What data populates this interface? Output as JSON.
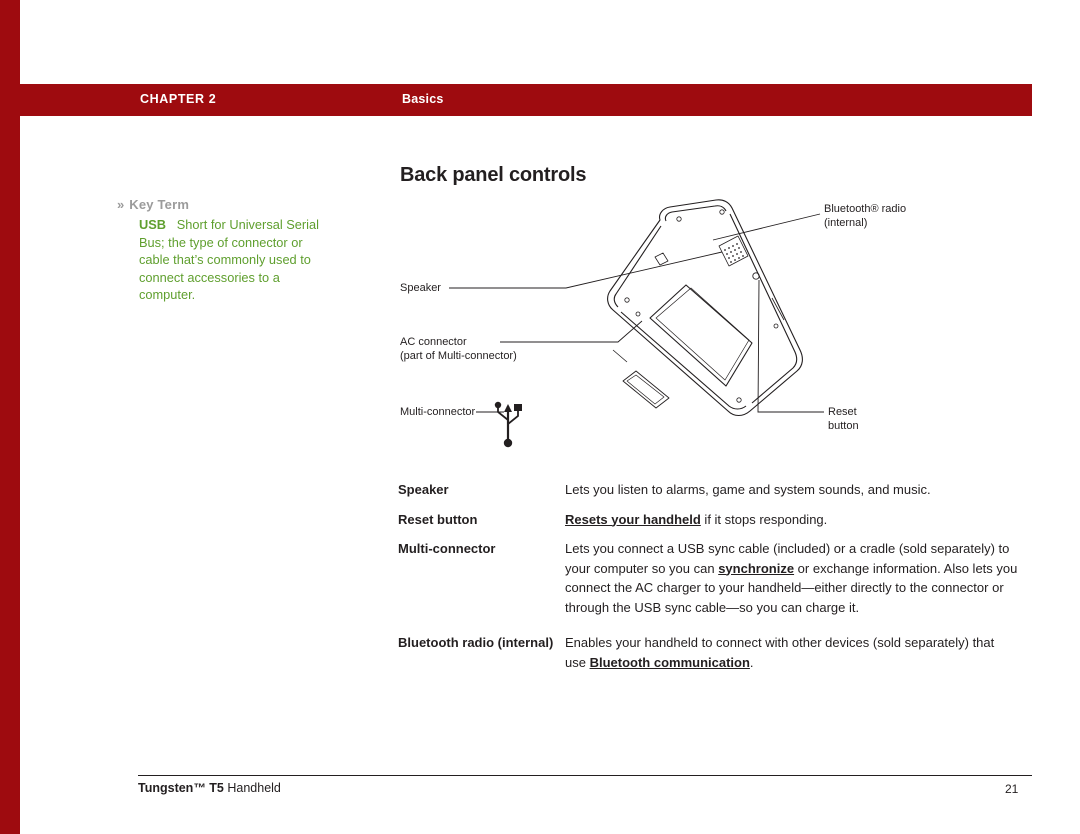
{
  "header": {
    "chapter": "CHAPTER 2",
    "section": "Basics",
    "band_color": "#9e0b0f"
  },
  "page": {
    "title": "Back panel controls"
  },
  "keyterm": {
    "chevrons": "»",
    "label": "Key Term",
    "term": "USB",
    "definition": "Short for Universal Serial Bus; the type of connector or cable that’s commonly used to connect accessories to a computer.",
    "color": "#5f9f2e"
  },
  "figure": {
    "labels": [
      {
        "name": "bluetooth-radio",
        "text": "Bluetooth® radio\n(internal)"
      },
      {
        "name": "speaker",
        "text": "Speaker"
      },
      {
        "name": "ac-connector",
        "text": "AC connector\n(part of Multi-connector)"
      },
      {
        "name": "multi-connector",
        "text": "Multi-connector"
      },
      {
        "name": "reset-button",
        "text": "Reset\nbutton"
      }
    ]
  },
  "definitions": [
    {
      "term": "Speaker",
      "desc_html": "Lets you listen to alarms, game and system sounds, and music."
    },
    {
      "term": "Reset button",
      "desc_html": "<span class=\"link-ul\">Resets your handheld</span> if it stops responding."
    },
    {
      "term": "Multi-connector",
      "desc_html": "Lets you connect a USB sync cable (included) or a cradle (sold separately) to your computer so you can <span class=\"link-ul\">synchronize</span> or exchange information. Also lets you connect the AC charger to your handheld—either directly to the connector or through the USB sync cable—so you can charge it."
    },
    {
      "term": "Bluetooth radio (internal)",
      "desc_html": "Enables your handheld to connect with other devices (sold separately) that use <span class=\"link-ul\">Bluetooth communication</span>."
    }
  ],
  "footer": {
    "brand": "Tungsten™ T5",
    "product": " Handheld",
    "page_number": "21"
  }
}
